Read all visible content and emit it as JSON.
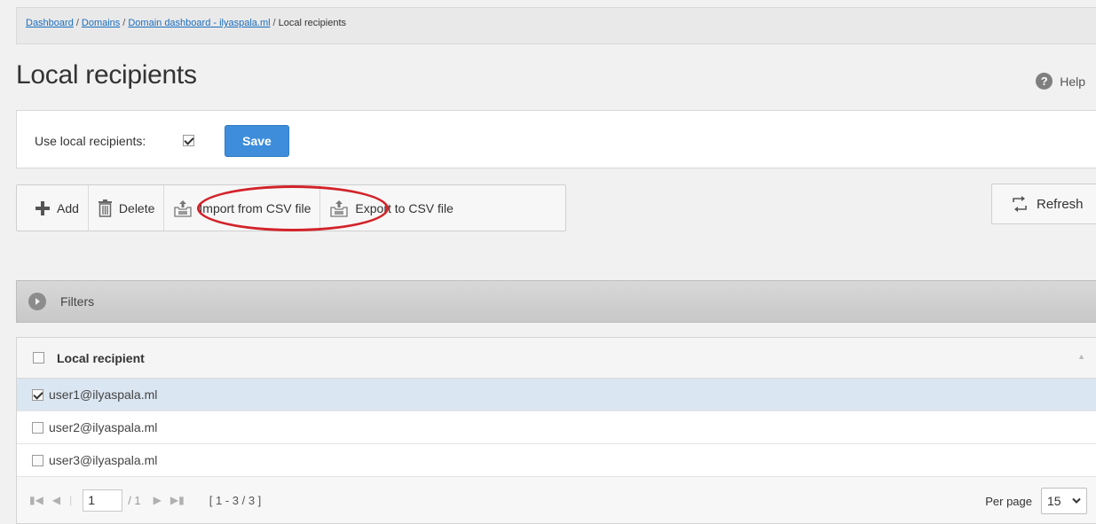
{
  "breadcrumb": {
    "items": [
      "Dashboard",
      "Domains",
      "Domain dashboard - ilyaspala.ml"
    ],
    "current": "Local recipients",
    "separator": "/"
  },
  "page": {
    "title": "Local recipients",
    "help_label": "Help",
    "help_glyph": "?"
  },
  "settings": {
    "use_local_label": "Use local recipients:",
    "use_local_checked": true,
    "save_label": "Save"
  },
  "toolbar": {
    "add_label": "Add",
    "delete_label": "Delete",
    "import_label": "Import from CSV file",
    "export_label": "Export to CSV file",
    "refresh_label": "Refresh"
  },
  "filters": {
    "label": "Filters"
  },
  "grid": {
    "header": "Local recipient",
    "rows": [
      {
        "email": "user1@ilyaspala.ml",
        "checked": true
      },
      {
        "email": "user2@ilyaspala.ml",
        "checked": false
      },
      {
        "email": "user3@ilyaspala.ml",
        "checked": false
      }
    ]
  },
  "pager": {
    "page": "1",
    "total": "/ 1",
    "range": "[ 1 - 3 / 3 ]",
    "per_page_label": "Per page",
    "per_page_value": "15"
  },
  "colors": {
    "save": "#3d8ddb",
    "link": "#1a6dbf",
    "highlight": "#d2232a",
    "selected_row": "#dae6f1"
  },
  "icons": [
    "help-icon",
    "add-icon",
    "delete-icon",
    "csv-import-icon",
    "csv-export-icon",
    "refresh-icon",
    "filter-expand-icon",
    "chevron-down-icon"
  ]
}
